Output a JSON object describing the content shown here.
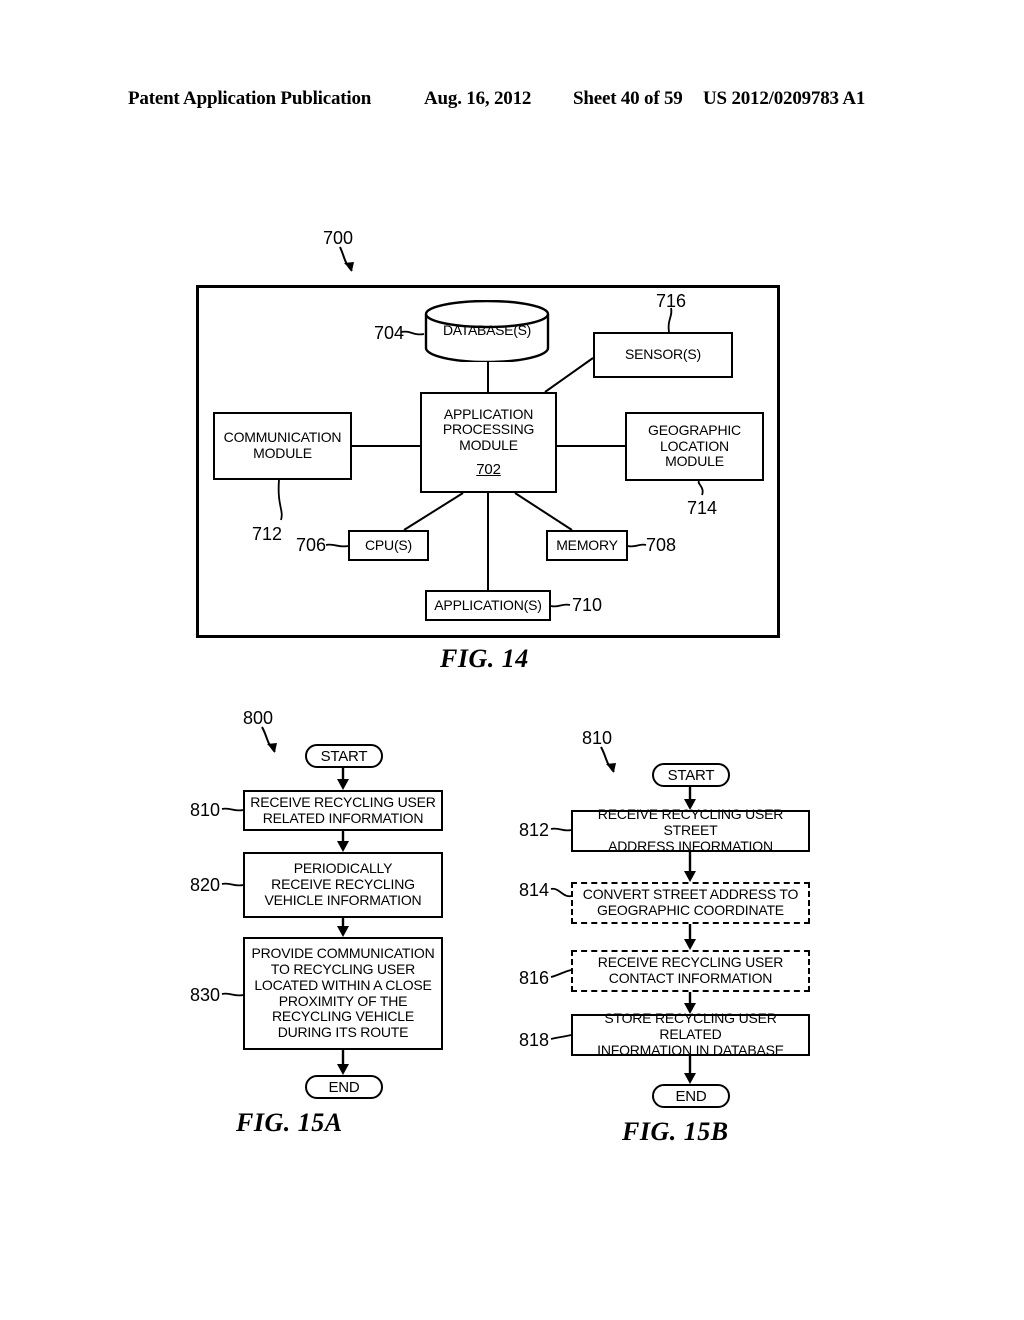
{
  "header": {
    "publication": "Patent Application Publication",
    "date": "Aug. 16, 2012",
    "sheet": "Sheet 40 of 59",
    "number": "US 2012/0209783 A1"
  },
  "fig14": {
    "caption": "FIG. 14",
    "system_ref": "700",
    "nodes": {
      "database": {
        "label": "DATABASE(S)",
        "ref": "704"
      },
      "sensors": {
        "label": "SENSOR(S)",
        "ref": "716"
      },
      "application_processing_module": {
        "line1": "APPLICATION",
        "line2": "PROCESSING",
        "line3": "MODULE",
        "ref": "702"
      },
      "communication_module": {
        "line1": "COMMUNICATION",
        "line2": "MODULE",
        "ref": "712"
      },
      "geographic_location_module": {
        "line1": "GEOGRAPHIC",
        "line2": "LOCATION",
        "line3": "MODULE",
        "ref": "714"
      },
      "cpus": {
        "label": "CPU(S)",
        "ref": "706"
      },
      "memory": {
        "label": "MEMORY",
        "ref": "708"
      },
      "applications": {
        "label": "APPLICATION(S)",
        "ref": "710"
      }
    }
  },
  "fig15a": {
    "caption": "FIG. 15A",
    "flow_ref": "800",
    "start_label": "START",
    "end_label": "END",
    "steps": [
      {
        "ref": "810",
        "line1": "RECEIVE RECYCLING USER",
        "line2": "RELATED INFORMATION",
        "style": "solid"
      },
      {
        "ref": "820",
        "line1": "PERIODICALLY",
        "line2": "RECEIVE RECYCLING",
        "line3": "VEHICLE INFORMATION",
        "style": "solid"
      },
      {
        "ref": "830",
        "line1": "PROVIDE COMMUNICATION",
        "line2": "TO RECYCLING USER",
        "line3": "LOCATED WITHIN A CLOSE",
        "line4": "PROXIMITY OF THE",
        "line5": "RECYCLING VEHICLE",
        "line6": "DURING ITS ROUTE",
        "style": "solid"
      }
    ]
  },
  "fig15b": {
    "caption": "FIG. 15B",
    "flow_ref": "810",
    "start_label": "START",
    "end_label": "END",
    "steps": [
      {
        "ref": "812",
        "line1": "RECEIVE RECYCLING USER STREET",
        "line2": "ADDRESS INFORMATION",
        "style": "solid"
      },
      {
        "ref": "814",
        "line1": "CONVERT STREET ADDRESS TO",
        "line2": "GEOGRAPHIC COORDINATE",
        "style": "dashed"
      },
      {
        "ref": "816",
        "line1": "RECEIVE RECYCLING USER",
        "line2": "CONTACT INFORMATION",
        "style": "dashed"
      },
      {
        "ref": "818",
        "line1": "STORE RECYCLING USER RELATED",
        "line2": "INFORMATION IN DATABASE",
        "style": "solid"
      }
    ]
  }
}
